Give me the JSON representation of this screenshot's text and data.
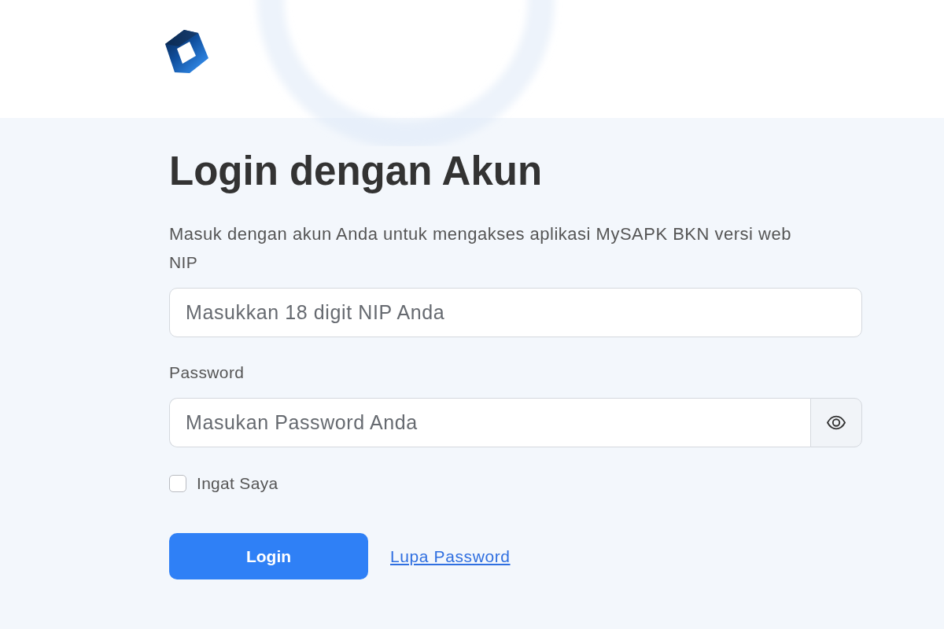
{
  "heading": "Login dengan Akun",
  "subtitle": "Masuk dengan akun Anda untuk mengakses aplikasi MySAPK BKN versi web",
  "fields": [
    {
      "kind": "text",
      "label": "NIP",
      "placeholder": "Masukkan 18 digit NIP Anda"
    },
    {
      "kind": "password",
      "label": "Password",
      "placeholder": "Masukan Password Anda"
    }
  ],
  "remember": {
    "label": "Ingat Saya",
    "checked": false
  },
  "login_button": {
    "label": "Login"
  },
  "forgot_link": {
    "label": "Lupa Password"
  }
}
